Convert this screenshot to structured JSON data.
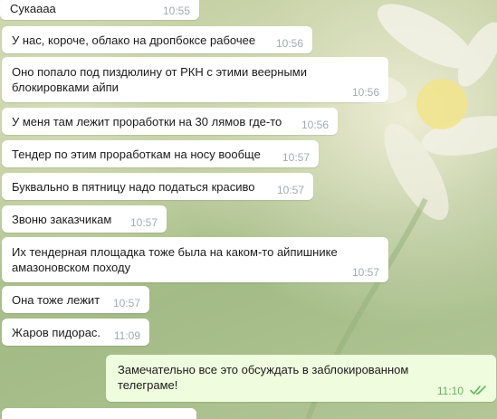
{
  "chat": {
    "messages": [
      {
        "text": "Сукаааа",
        "time": "10:55",
        "direction": "in"
      },
      {
        "text": "У нас, короче, облако на дропбоксе рабочее",
        "time": "10:56",
        "direction": "in"
      },
      {
        "text": "Оно попало под пиздюлину от РКН с этими веерными\nблокировками айпи",
        "time": "10:56",
        "direction": "in"
      },
      {
        "text": "У меня там лежит проработки на 30 лямов где-то",
        "time": "10:56",
        "direction": "in"
      },
      {
        "text": "Тендер по этим проработкам на носу вообще",
        "time": "10:57",
        "direction": "in"
      },
      {
        "text": "Буквально в пятницу надо податься красиво",
        "time": "10:57",
        "direction": "in"
      },
      {
        "text": "Звоню заказчикам",
        "time": "10:57",
        "direction": "in"
      },
      {
        "text": "Их тендерная площадка тоже была на каком-то айпишнике\nамазоновском походу",
        "time": "10:57",
        "direction": "in"
      },
      {
        "text": "Она тоже лежит",
        "time": "10:57",
        "direction": "in"
      },
      {
        "text": "Жаров пидорас.",
        "time": "11:09",
        "direction": "in"
      },
      {
        "text": "Замечательно все это обсуждать в заблокированном\nтелеграме!",
        "time": "11:10",
        "direction": "out",
        "status_icon": "double-check-icon"
      }
    ]
  },
  "colors": {
    "incoming_bubble": "#ffffff",
    "outgoing_bubble": "#effdde",
    "incoming_time": "#a3aab2",
    "outgoing_time": "#6cad61",
    "read_check": "#5dbb5a",
    "text": "#1b1b1b"
  }
}
